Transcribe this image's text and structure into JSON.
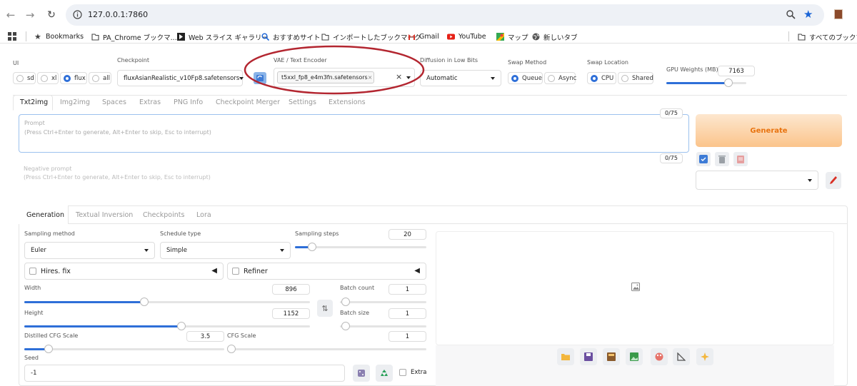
{
  "browser": {
    "url": "127.0.0.1:7860",
    "bookmarks": [
      {
        "label": "Bookmarks",
        "icon": "star-icon"
      },
      {
        "label": "PA_Chrome ブックマ...",
        "icon": "folder-icon"
      },
      {
        "label": "Web スライス ギャラリー",
        "icon": "webslice-icon"
      },
      {
        "label": "おすすめサイト",
        "icon": "search-icon"
      },
      {
        "label": "インポートしたブックマーク",
        "icon": "folder-icon"
      },
      {
        "label": "Gmail",
        "icon": "gmail-icon"
      },
      {
        "label": "YouTube",
        "icon": "youtube-icon"
      },
      {
        "label": "マップ",
        "icon": "maps-icon"
      },
      {
        "label": "新しいタブ",
        "icon": "globe-icon"
      }
    ],
    "all_bookmarks": "すべてのブックマ"
  },
  "top": {
    "ui_label": "UI",
    "ui_options": [
      "sd",
      "xl",
      "flux",
      "all"
    ],
    "ui_selected": "flux",
    "checkpoint_label": "Checkpoint",
    "checkpoint_value": "fluxAsianRealistic_v10Fp8.safetensors",
    "vae_label": "VAE / Text Encoder",
    "vae_chip": "t5xxl_fp8_e4m3fn.safetensors",
    "vae_chip_x": "×",
    "vae_clear": "×",
    "diffusion_label": "Diffusion in Low Bits",
    "diffusion_value": "Automatic",
    "swap_method_label": "Swap Method",
    "swap_method_options": [
      "Queue",
      "Async"
    ],
    "swap_location_label": "Swap Location",
    "swap_location_options": [
      "CPU",
      "Shared"
    ],
    "gpu_label": "GPU Weights (MB)",
    "gpu_value": "7163",
    "gpu_fraction": 0.78
  },
  "tabs": [
    "Txt2img",
    "Img2img",
    "Spaces",
    "Extras",
    "PNG Info",
    "Checkpoint Merger",
    "Settings",
    "Extensions"
  ],
  "prompt": {
    "label": "Prompt",
    "hint": "(Press Ctrl+Enter to generate, Alt+Enter to skip, Esc to interrupt)",
    "counter": "0/75",
    "neg_label": "Negative prompt",
    "neg_hint": "(Press Ctrl+Enter to generate, Alt+Enter to skip, Esc to interrupt)",
    "neg_counter": "0/75"
  },
  "generate": {
    "label": "Generate"
  },
  "subtabs": [
    "Generation",
    "Textual Inversion",
    "Checkpoints",
    "Lora"
  ],
  "params": {
    "sampling_method_label": "Sampling method",
    "sampling_method": "Euler",
    "schedule_type_label": "Schedule type",
    "schedule_type": "Simple",
    "sampling_steps_label": "Sampling steps",
    "sampling_steps": "20",
    "sampling_steps_fraction": 0.13,
    "hires_label": "Hires. fix",
    "refiner_label": "Refiner",
    "width_label": "Width",
    "width": "896",
    "width_fraction": 0.42,
    "height_label": "Height",
    "height": "1152",
    "height_fraction": 0.55,
    "swap_icon": "⇅",
    "batch_count_label": "Batch count",
    "batch_count": "1",
    "batch_size_label": "Batch size",
    "batch_size": "1",
    "distilled_label": "Distilled CFG Scale",
    "distilled": "3.5",
    "distilled_fraction": 0.12,
    "cfg_label": "CFG Scale",
    "cfg": "1",
    "seed_label": "Seed",
    "seed": "-1",
    "extra_label": "Extra"
  },
  "colors": {
    "accent": "#2e6fd8",
    "generate_from": "#fde7cf",
    "generate_to": "#fbc48b",
    "generate_text": "#e8730f",
    "annotation": "#b32630"
  }
}
